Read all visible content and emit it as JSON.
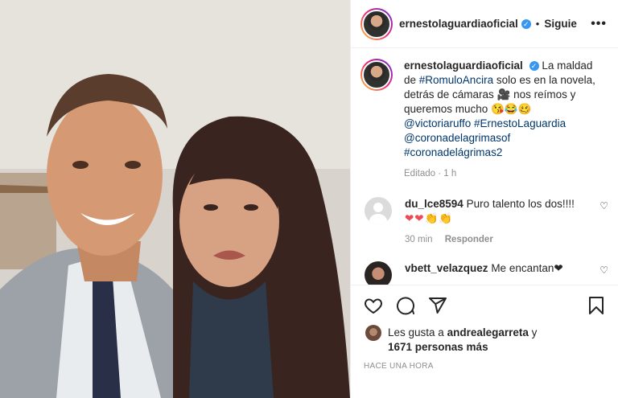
{
  "post": {
    "username": "ernestolaguardiaoficial",
    "follow_label": "Siguie",
    "dot": "•",
    "more": "•••",
    "verified_glyph": "✓"
  },
  "caption": {
    "username": "ernestolaguardiaoficial",
    "text_1": "La maldad de ",
    "tag_1": "#RomuloAncira",
    "text_2": " solo es en la novela, detrás de cámaras 🎥 nos reímos y queremos mucho 😘😂🥴 ",
    "tag_2": "@victoriaruffo",
    "text_3": " ",
    "tag_3": "#ErnestoLaguardia",
    "text_4": " ",
    "tag_4": "@coronadelagrimasof",
    "text_5": " ",
    "tag_5": "#coronadelágrimas2",
    "meta": "Editado · 1 h"
  },
  "comments": [
    {
      "username": "du_lce8594",
      "text": "Puro talento los dos!!!!",
      "emojis": "❤❤👏👏",
      "time": "30 min",
      "reply": "Responder"
    },
    {
      "username": "vbett_velazquez",
      "text": "Me encantan❤",
      "emojis": "",
      "time": "",
      "reply": ""
    }
  ],
  "likes": {
    "prefix": "Les gusta a ",
    "user": "andrealegarreta",
    "suffix": " y",
    "count": "1671 personas más"
  },
  "timestamp": "HACE UNA HORA",
  "icons": [
    "heart-icon",
    "comment-icon",
    "share-icon",
    "save-icon",
    "more-icon",
    "verified-icon"
  ]
}
